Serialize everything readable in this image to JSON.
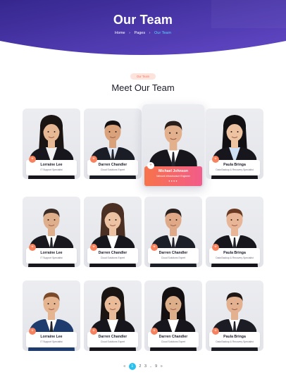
{
  "hero": {
    "title": "Our Team",
    "breadcrumb": [
      "Home",
      "Pages",
      "Our Team"
    ],
    "colors": {
      "start": "#3a2a9a",
      "end": "#6b4fd8"
    }
  },
  "section": {
    "badge": "Our Team",
    "title": "Meet Our Team"
  },
  "members": [
    {
      "name": "Lorraine Lee",
      "role": "IT Support Specialist",
      "gender": "f",
      "skin": "#e7b894",
      "hair": "#1a1413",
      "suit": "#16161c",
      "shirt": "#f2f2f2"
    },
    {
      "name": "Darren Chandler",
      "role": "Cloud Solutions Expert",
      "gender": "m",
      "skin": "#d9a27b",
      "hair": "#141012",
      "suit": "#1b1d26",
      "shirt": "#dfe7f4"
    },
    {
      "name": "Michael Johnson",
      "role": "Network Infrastructure Engineer",
      "gender": "m",
      "skin": "#e3b08d",
      "hair": "#2a1f1b",
      "suit": "#16161c",
      "shirt": "#ffffff",
      "highlight": true,
      "socials": [
        "facebook-icon",
        "twitter-icon",
        "instagram-icon",
        "linkedin-icon"
      ]
    },
    {
      "name": "Paula Bringa",
      "role": "Data Backup & Recovery Specialist",
      "gender": "f",
      "skin": "#edc3a1",
      "hair": "#121012",
      "suit": "#16161c",
      "shirt": "#cfe0f5"
    },
    {
      "name": "Lorraine Lee",
      "role": "IT Support Specialist",
      "gender": "m",
      "skin": "#dfae8b",
      "hair": "#3b2d26",
      "suit": "#18181e",
      "shirt": "#ffffff"
    },
    {
      "name": "Darren Chandler",
      "role": "Cloud Solutions Expert",
      "gender": "f",
      "skin": "#ecc2a2",
      "hair": "#4a2f22",
      "suit": "#16161c",
      "shirt": "#ffffff"
    },
    {
      "name": "Darren Chandler",
      "role": "Cloud Solutions Expert",
      "gender": "m",
      "skin": "#dfa987",
      "hair": "#2b2220",
      "suit": "#1d1f28",
      "shirt": "#f2f2f2"
    },
    {
      "name": "Paula Bringa",
      "role": "Data Backup & Recovery Specialist",
      "gender": "m",
      "skin": "#e8b697",
      "hair": "#6b3a22",
      "suit": "#16161c",
      "shirt": "#ffffff"
    },
    {
      "name": "Lorraine Lee",
      "role": "IT Support Specialist",
      "gender": "m",
      "skin": "#e5b490",
      "hair": "#7a4a2a",
      "suit": "#1e3c6e",
      "shirt": "#ffffff"
    },
    {
      "name": "Darren Chandler",
      "role": "Cloud Solutions Expert",
      "gender": "f",
      "skin": "#e9bb98",
      "hair": "#1a1412",
      "suit": "#16161c",
      "shirt": "#ffffff"
    },
    {
      "name": "Darren Chandler",
      "role": "Cloud Solutions Expert",
      "gender": "f",
      "skin": "#dcae8a",
      "hair": "#141012",
      "suit": "#16161c",
      "shirt": "#ffffff"
    },
    {
      "name": "Paula Bringa",
      "role": "Data Backup & Recovery Specialist",
      "gender": "m",
      "skin": "#e3b18f",
      "hair": "#1f1714",
      "suit": "#1c1d24",
      "shirt": "#ffffff"
    }
  ],
  "share_icon": "share-icon",
  "pagination": {
    "prev": "«",
    "pages": [
      "1",
      "2",
      "3",
      "..",
      "9"
    ],
    "active": "1",
    "next": "»"
  }
}
